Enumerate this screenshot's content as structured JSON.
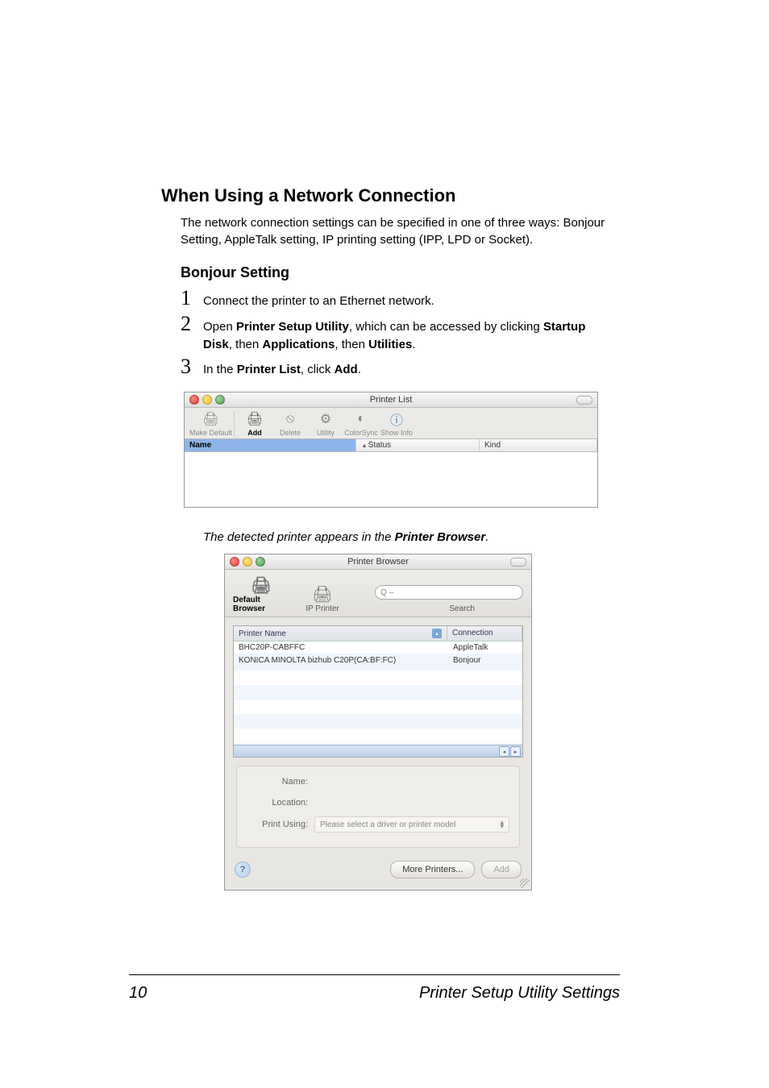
{
  "headings": {
    "h1": "When Using a Network Connection",
    "h2": "Bonjour Setting"
  },
  "intro": "The network connection settings can be specified in one of three ways: Bonjour Setting, AppleTalk setting, IP printing setting (IPP, LPD or Socket).",
  "steps": {
    "s1": {
      "num": "1",
      "text": "Connect the printer to an Ethernet network."
    },
    "s2": {
      "num": "2",
      "pre": "Open ",
      "b1": "Printer Setup Utility",
      "mid1": ", which can be accessed by clicking ",
      "b2": "Startup Disk",
      "mid2": ", then ",
      "b3": "Applications",
      "mid3": ", then ",
      "b4": "Utilities",
      "post": "."
    },
    "s3": {
      "num": "3",
      "pre": "In the ",
      "b1": "Printer List",
      "mid": ", click ",
      "b2": "Add",
      "post": "."
    }
  },
  "printer_list": {
    "title": "Printer List",
    "toolbar": {
      "make_default": "Make Default",
      "add": "Add",
      "delete": "Delete",
      "utility": "Utility",
      "colorsync": "ColorSync",
      "show_info": "Show Info"
    },
    "columns": {
      "name": "Name",
      "status": "Status",
      "kind": "Kind"
    }
  },
  "caption": {
    "pre": "The detected printer appears in the ",
    "b": "Printer Browser",
    "post": "."
  },
  "printer_browser": {
    "title": "Printer Browser",
    "tabs": {
      "default": "Default Browser",
      "ip": "IP Printer"
    },
    "search": {
      "glyph": "Q",
      "dash": "–",
      "label": "Search"
    },
    "list": {
      "columns": {
        "name": "Printer Name",
        "conn": "Connection"
      },
      "rows": [
        {
          "name": "BHC20P-CABFFC",
          "conn": "AppleTalk"
        },
        {
          "name": "KONICA MINOLTA bizhub C20P(CA:BF:FC)",
          "conn": "Bonjour"
        }
      ]
    },
    "form": {
      "name_label": "Name:",
      "location_label": "Location:",
      "print_using_label": "Print Using:",
      "print_using_value": "Please select a driver or printer model"
    },
    "footer": {
      "more": "More Printers...",
      "add": "Add"
    }
  },
  "footer": {
    "page": "10",
    "title": "Printer Setup Utility Settings"
  }
}
